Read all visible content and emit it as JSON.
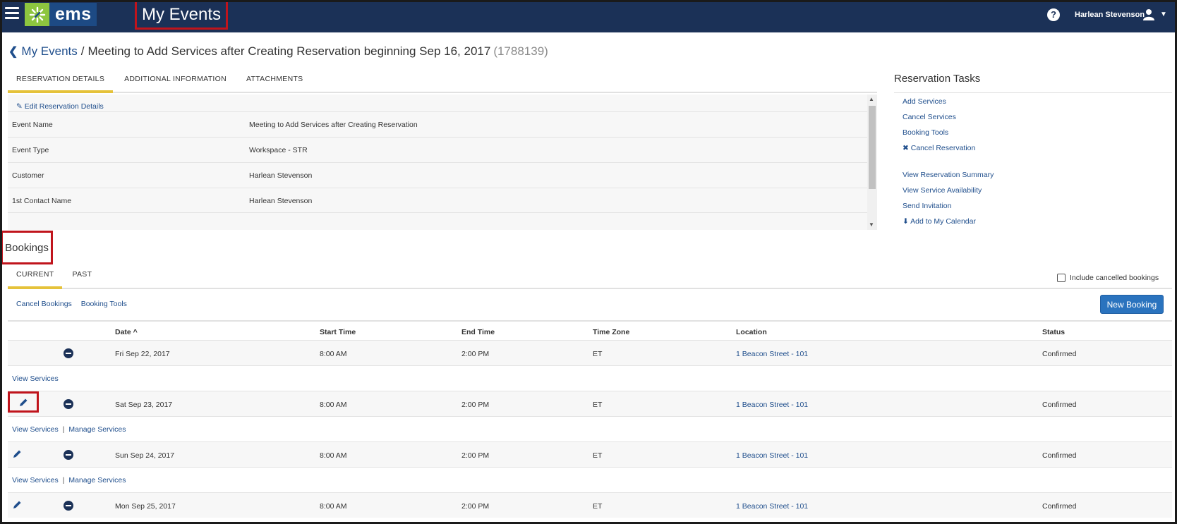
{
  "app": {
    "logo_text": "ems",
    "title": "My Events",
    "help": "?",
    "user_name": "Harlean Stevenson"
  },
  "breadcrumb": {
    "root": "My Events",
    "separator": "/",
    "title": "Meeting to Add Services after Creating Reservation beginning Sep 16, 2017",
    "id": "(1788139)"
  },
  "reservation_tabs": [
    "RESERVATION DETAILS",
    "ADDITIONAL INFORMATION",
    "ATTACHMENTS"
  ],
  "details": {
    "edit_label": "Edit Reservation Details",
    "rows": [
      {
        "label": "Event Name",
        "value": "Meeting to Add Services after Creating Reservation"
      },
      {
        "label": "Event Type",
        "value": "Workspace - STR"
      },
      {
        "label": "Customer",
        "value": "Harlean Stevenson"
      },
      {
        "label": "1st Contact Name",
        "value": "Harlean Stevenson"
      }
    ]
  },
  "tasks": {
    "title": "Reservation Tasks",
    "items": [
      "Add Services",
      "Cancel Services",
      "Booking Tools",
      "Cancel Reservation",
      "View Reservation Summary",
      "View Service Availability",
      "Send Invitation",
      "Add to My Calendar"
    ]
  },
  "bookings": {
    "title": "Bookings",
    "tabs": [
      "CURRENT",
      "PAST"
    ],
    "include_cancelled": "Include cancelled bookings",
    "actions": [
      "Cancel Bookings",
      "Booking Tools"
    ],
    "new_booking": "New Booking",
    "columns": [
      "Date ^",
      "Start Time",
      "End Time",
      "Time Zone",
      "Location",
      "Status"
    ],
    "rows": [
      {
        "date": "Fri Sep 22, 2017",
        "start": "8:00 AM",
        "end": "2:00 PM",
        "tz": "ET",
        "location": "1 Beacon Street - 101",
        "status": "Confirmed",
        "services": "View Services"
      },
      {
        "date": "Sat Sep 23, 2017",
        "start": "8:00 AM",
        "end": "2:00 PM",
        "tz": "ET",
        "location": "1 Beacon Street - 101",
        "status": "Confirmed",
        "services": "View Services",
        "manage": "Manage Services"
      },
      {
        "date": "Sun Sep 24, 2017",
        "start": "8:00 AM",
        "end": "2:00 PM",
        "tz": "ET",
        "location": "1 Beacon Street - 101",
        "status": "Confirmed",
        "services": "View Services",
        "manage": "Manage Services"
      },
      {
        "date": "Mon Sep 25, 2017",
        "start": "8:00 AM",
        "end": "2:00 PM",
        "tz": "ET",
        "location": "1 Beacon Street - 101",
        "status": "Confirmed"
      }
    ],
    "services_separator": "|"
  },
  "colors": {
    "nav_bg": "#1b3157",
    "logo_green": "#8dc63f",
    "link": "#1f4e8c",
    "tab_accent": "#e5c23a",
    "primary_button": "#2a73be",
    "highlight_red": "#c0141c"
  }
}
